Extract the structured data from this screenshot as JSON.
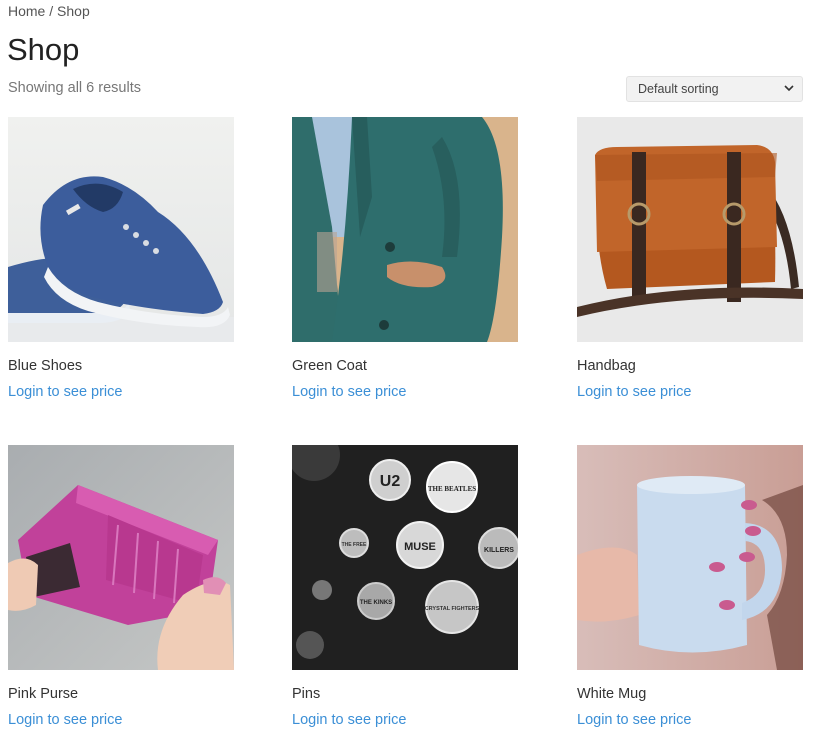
{
  "breadcrumb": {
    "home": "Home",
    "separator": " / ",
    "current": "Shop"
  },
  "page": {
    "title": "Shop",
    "result_count": "Showing all 6 results"
  },
  "sorting": {
    "selected": "Default sorting",
    "icon": "chevron-down-icon"
  },
  "colors": {
    "link": "#3b8fd6",
    "text": "#333333",
    "muted": "#777777"
  },
  "products": [
    {
      "name": "Blue Shoes",
      "price_link": "Login to see price",
      "image": "blue-shoes"
    },
    {
      "name": "Green Coat",
      "price_link": "Login to see price",
      "image": "green-coat"
    },
    {
      "name": "Handbag",
      "price_link": "Login to see price",
      "image": "handbag"
    },
    {
      "name": "Pink Purse",
      "price_link": "Login to see price",
      "image": "pink-purse"
    },
    {
      "name": "Pins",
      "price_link": "Login to see price",
      "image": "pins",
      "image_text": [
        "U2",
        "THE BEATLES",
        "MUSE",
        "KILLERS",
        "THE KINKS",
        "CRYSTAL FIGHTERS",
        "THE FREE"
      ]
    },
    {
      "name": "White Mug",
      "price_link": "Login to see price",
      "image": "white-mug"
    }
  ]
}
